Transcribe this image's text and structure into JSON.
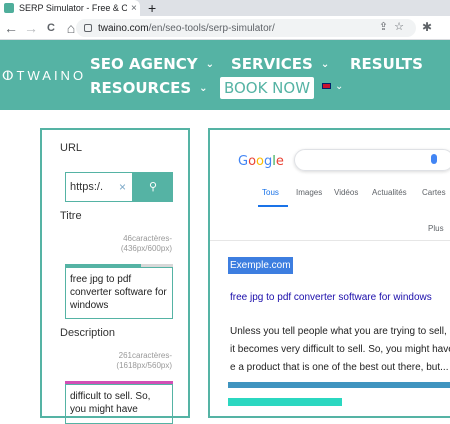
{
  "browser": {
    "tab_title": "SERP Simulator - Free & Online |",
    "tab_close": "×",
    "new_tab": "+",
    "url_domain": "twaino.com",
    "url_path": "/en/seo-tools/serp-simulator/",
    "nav_back": "←",
    "nav_forward": "→",
    "nav_reload": "C",
    "nav_home": "⌂"
  },
  "site": {
    "logo": "TWAINO",
    "nav": {
      "seo_agency": "SEO AGENCY",
      "services": "SERVICES",
      "results": "RESULTS",
      "resources": "RESOURCES",
      "book_now": "BOOK NOW"
    },
    "colors": {
      "brand": "#55b3a4",
      "google_blue": "#1a73e8",
      "link": "#1a0dab"
    }
  },
  "form": {
    "url_label": "URL",
    "url_value": "https:/.",
    "clear_icon": "×",
    "title_label": "Titre",
    "title_counter_chars": "46caractères-",
    "title_counter_px": "(436px/600px)",
    "title_value": "free jpg to pdf converter software for windows",
    "description_label": "Description",
    "desc_counter_chars": "261caractères-",
    "desc_counter_px": "(1618px/560px)",
    "desc_value": "difficult to sell. So, you might have"
  },
  "serp": {
    "tabs": [
      "Tous",
      "Images",
      "Vidéos",
      "Actualités",
      "Cartes"
    ],
    "plus": "Plus",
    "example_url": "Exemple.com",
    "result_title": "free jpg to pdf converter software for windows",
    "result_desc_lines": [
      "Unless you tell people what you are trying to sell, it",
      "it becomes very difficult to sell. So, you might have",
      "e a product that is one of the best out there, but..."
    ]
  }
}
